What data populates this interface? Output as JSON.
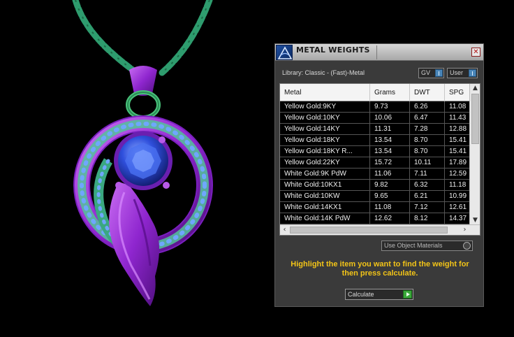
{
  "panel": {
    "title": "METAL WEIGHTS",
    "close_symbol": "✕",
    "icon": "app-logo-icon",
    "library_label": "Library: Classic - (Fast)-Metal",
    "gv_label": "GV",
    "user_label": "User",
    "use_object_materials_label": "Use Object Materials",
    "instructions": "Highlight the item you want to find the weight for then press calculate.",
    "calculate_label": "Calculate"
  },
  "table": {
    "headers": [
      "Metal",
      "Grams",
      "DWT",
      "SPG"
    ],
    "rows": [
      [
        "Yellow Gold:9KY",
        "9.73",
        "6.26",
        "11.08"
      ],
      [
        "Yellow Gold:10KY",
        "10.06",
        "6.47",
        "11.43"
      ],
      [
        "Yellow Gold:14KY",
        "11.31",
        "7.28",
        "12.88"
      ],
      [
        "Yellow Gold:18KY",
        "13.54",
        "8.70",
        "15.41"
      ],
      [
        "Yellow Gold:18KY R...",
        "13.54",
        "8.70",
        "15.41"
      ],
      [
        "Yellow Gold:22KY",
        "15.72",
        "10.11",
        "17.89"
      ],
      [
        "White Gold:9K PdW",
        "11.06",
        "7.11",
        "12.59"
      ],
      [
        "White Gold:10KX1",
        "9.82",
        "6.32",
        "11.18"
      ],
      [
        "White Gold:10KW",
        "9.65",
        "6.21",
        "10.99"
      ],
      [
        "White Gold:14KX1",
        "11.08",
        "7.12",
        "12.61"
      ],
      [
        "White Gold:14K PdW",
        "12.62",
        "8.12",
        "14.37"
      ]
    ]
  },
  "colors": {
    "accent_yellow": "#f2c418",
    "panel_bg": "#3a3a3a",
    "pendant_purple": "#9a2fd6",
    "chain_green": "#2e9c6e",
    "gem_blue": "#2848c8"
  }
}
